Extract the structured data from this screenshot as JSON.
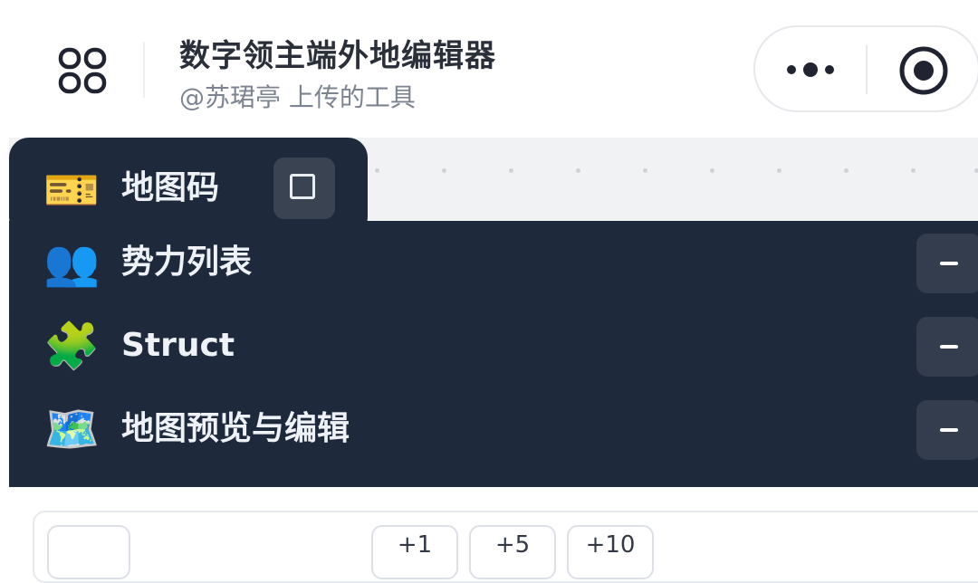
{
  "header": {
    "title": "数字领主端外地编辑器",
    "subtitle": "@苏珺亭 上传的工具",
    "icons": {
      "apps": "apps-grid-icon",
      "more": "more-dots-icon",
      "close": "target-close-icon"
    }
  },
  "map_code": {
    "label": "地图码",
    "emoji": "🎫",
    "checked": false
  },
  "sections": [
    {
      "label": "势力列表",
      "emoji": "👥",
      "button": "collapse"
    },
    {
      "label": "Struct",
      "emoji": "🧩",
      "button": "collapse"
    },
    {
      "label": "地图预览与编辑",
      "emoji": "🗺️",
      "button": "collapse"
    }
  ],
  "bottom": {
    "steps": [
      "+1",
      "+5",
      "+10"
    ]
  },
  "colors": {
    "panel": "#1e293b",
    "button": "#343d4d",
    "text_light": "#eef2f7"
  }
}
